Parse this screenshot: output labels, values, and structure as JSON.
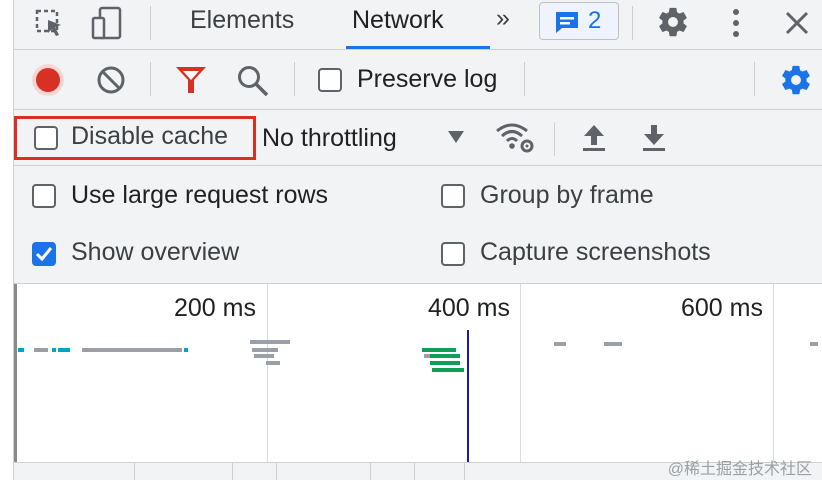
{
  "tabs": {
    "elements": "Elements",
    "network": "Network",
    "more": "»",
    "badge_count": "2"
  },
  "toolbar": {
    "preserve_log": "Preserve log"
  },
  "toolbar2": {
    "disable_cache": "Disable cache",
    "throttling": "No throttling"
  },
  "settings": {
    "use_large_rows": "Use large request rows",
    "group_by_frame": "Group by frame",
    "show_overview": "Show overview",
    "capture_screenshots": "Capture screenshots",
    "use_large_rows_checked": false,
    "group_by_frame_checked": false,
    "show_overview_checked": true,
    "capture_screenshots_checked": false
  },
  "overview": {
    "ticks": [
      "200 ms",
      "400 ms",
      "600 ms"
    ]
  },
  "watermark": "@稀土掘金技术社区",
  "colors": {
    "accent": "#1a73e8",
    "record": "#d93025",
    "filter": "#d93025",
    "highlight_box": "#d93025"
  }
}
